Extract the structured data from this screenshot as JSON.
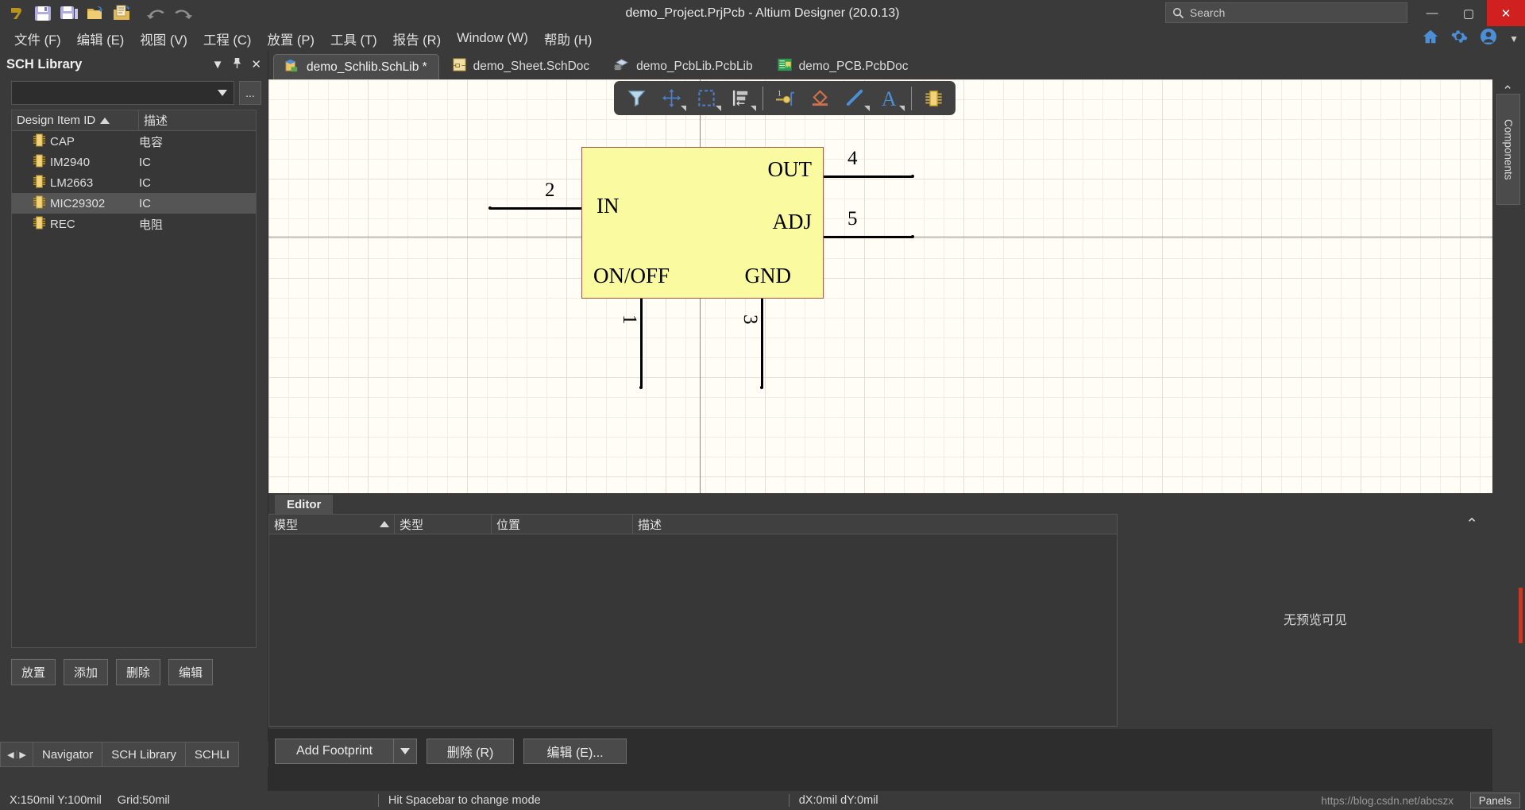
{
  "titlebar": {
    "title": "demo_Project.PrjPcb - Altium Designer (20.0.13)",
    "search_placeholder": "Search",
    "minimize": "—",
    "maximize": "▢",
    "close": "✕"
  },
  "menu": {
    "items": [
      {
        "label": "文件 (F)"
      },
      {
        "label": "编辑 (E)"
      },
      {
        "label": "视图 (V)"
      },
      {
        "label": "工程 (C)"
      },
      {
        "label": "放置 (P)"
      },
      {
        "label": "工具 (T)"
      },
      {
        "label": "报告 (R)"
      },
      {
        "label": "Window (W)"
      },
      {
        "label": "帮助 (H)"
      }
    ]
  },
  "sidebar": {
    "title": "SCH Library",
    "filter_value": "",
    "ellipsis_label": "...",
    "columns": [
      "Design Item ID",
      "描述"
    ],
    "items": [
      {
        "name": "CAP",
        "desc": "电容"
      },
      {
        "name": "IM2940",
        "desc": "IC"
      },
      {
        "name": "LM2663",
        "desc": "IC"
      },
      {
        "name": "MIC29302",
        "desc": "IC"
      },
      {
        "name": "REC",
        "desc": "电阻"
      }
    ],
    "selected_index": 3,
    "buttons": [
      "放置",
      "添加",
      "删除",
      "编辑"
    ],
    "panel_tabs": [
      "Navigator",
      "SCH Library",
      "SCHLI"
    ]
  },
  "doc_tabs": [
    {
      "label": "demo_Schlib.SchLib *",
      "active": true
    },
    {
      "label": "demo_Sheet.SchDoc",
      "active": false
    },
    {
      "label": "demo_PcbLib.PcbLib",
      "active": false
    },
    {
      "label": "demo_PCB.PcbDoc",
      "active": false
    }
  ],
  "float_toolbar": {
    "tools": [
      "filter-icon",
      "move-icon",
      "select-rect-icon",
      "align-icon",
      "pin-icon",
      "ieee-symbol-icon",
      "line-icon",
      "text-icon",
      "component-icon"
    ]
  },
  "schematic": {
    "body_fill": "#fafaa0",
    "body_border": "#9c5a44",
    "pins": [
      {
        "number": "2",
        "name": "IN",
        "side": "left"
      },
      {
        "number": "4",
        "name": "OUT",
        "side": "right"
      },
      {
        "number": "5",
        "name": "ADJ",
        "side": "right"
      },
      {
        "number": "1",
        "name": "ON/OFF",
        "side": "bottom"
      },
      {
        "number": "3",
        "name": "GND",
        "side": "bottom"
      }
    ]
  },
  "editor": {
    "tab_label": "Editor",
    "table_columns": [
      "模型",
      "类型",
      "位置",
      "描述"
    ],
    "rows": [],
    "preview_text": "无预览可见"
  },
  "bottom_buttons": {
    "add_footprint": "Add Footprint",
    "delete": "删除 (R)",
    "edit": "编辑 (E)..."
  },
  "right_dock": {
    "vertical_tab": "Components"
  },
  "statusbar": {
    "coords": "X:150mil Y:100mil",
    "grid": "Grid:50mil",
    "hint": "Hit Spacebar to change mode",
    "delta": "dX:0mil dY:0mil",
    "watermark": "https://blog.csdn.net/abcszx",
    "panels": "Panels"
  }
}
